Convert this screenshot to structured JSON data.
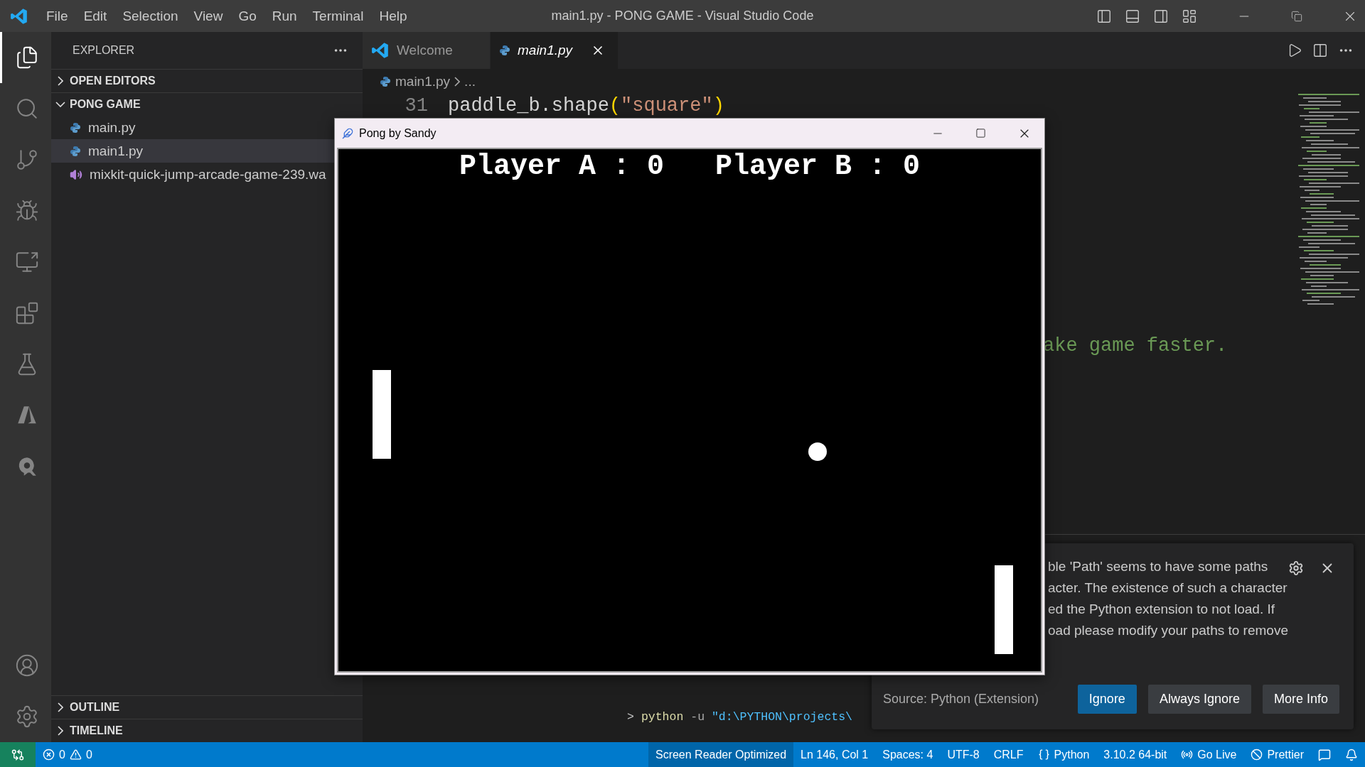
{
  "title_bar": {
    "menu": [
      "File",
      "Edit",
      "Selection",
      "View",
      "Go",
      "Run",
      "Terminal",
      "Help"
    ],
    "title": "main1.py - PONG GAME - Visual Studio Code"
  },
  "activity_bar": {
    "items": [
      {
        "kind": "files",
        "selected": true
      },
      {
        "kind": "search",
        "selected": false
      },
      {
        "kind": "source-control",
        "selected": false
      },
      {
        "kind": "run-debug",
        "selected": false
      },
      {
        "kind": "remote",
        "selected": false
      },
      {
        "kind": "extensions",
        "selected": false
      },
      {
        "kind": "testing",
        "selected": false
      },
      {
        "kind": "azure",
        "selected": false
      },
      {
        "kind": "r-logo",
        "selected": false
      }
    ],
    "bottom": [
      {
        "kind": "accounts",
        "selected": false
      },
      {
        "kind": "settings",
        "selected": false
      }
    ]
  },
  "sidebar": {
    "title": "EXPLORER",
    "sections": [
      {
        "label": "OPEN EDITORS",
        "expanded": false
      },
      {
        "label": "PONG GAME",
        "expanded": true,
        "files": [
          {
            "name": "main.py",
            "kind": "python",
            "selected": false
          },
          {
            "name": "main1.py",
            "kind": "python",
            "selected": true
          },
          {
            "name": "mixkit-quick-jump-arcade-game-239.wa",
            "kind": "audio",
            "selected": false
          }
        ]
      }
    ],
    "bottom_sections": [
      {
        "label": "OUTLINE",
        "expanded": false
      },
      {
        "label": "TIMELINE",
        "expanded": false
      }
    ]
  },
  "tabs": [
    {
      "label": "Welcome",
      "kind": "welcome",
      "selected": false
    },
    {
      "label": "main1.py",
      "kind": "python",
      "selected": true
    }
  ],
  "breadcrumb": [
    "main1.py",
    "..."
  ],
  "editor_lines": [
    {
      "number": "31",
      "tokens": [
        {
          "kind": "plain",
          "text": "paddle_b.shape"
        },
        {
          "kind": "paren",
          "text": "("
        },
        {
          "kind": "string",
          "text": "\"square\""
        },
        {
          "kind": "paren",
          "text": ")"
        }
      ]
    },
    {
      "tokens": [
        {
          "kind": "comment",
          "text": "ake game faster."
        }
      ]
    }
  ],
  "terminal": {
    "prompt": ">",
    "command": "python",
    "flag": "-u",
    "path": "\"d:\\PYTHON\\projects\\"
  },
  "notification": {
    "lines": [
      "ble 'Path' seems to have some paths",
      "acter. The existence of such a character",
      "ed the Python extension to not load. If",
      "oad please modify your paths to remove"
    ],
    "source": "Source: Python (Extension)",
    "buttons": [
      {
        "label": "Ignore",
        "primary": true
      },
      {
        "label": "Always Ignore",
        "primary": false
      },
      {
        "label": "More Info",
        "primary": false
      }
    ]
  },
  "pong_window": {
    "title": "Pong by Sandy",
    "scores": [
      "Player A : 0",
      "Player B : 0"
    ]
  },
  "status_bar": {
    "errors": "0",
    "warnings": "0",
    "items": [
      {
        "kind": "highlight",
        "text": "Screen Reader Optimized"
      },
      {
        "kind": "plain",
        "text": "Ln 146, Col 1"
      },
      {
        "kind": "plain",
        "text": "Spaces: 4"
      },
      {
        "kind": "plain",
        "text": "UTF-8"
      },
      {
        "kind": "plain",
        "text": "CRLF"
      },
      {
        "kind": "language",
        "text": "Python"
      },
      {
        "kind": "plain",
        "text": "3.10.2 64-bit"
      },
      {
        "kind": "broadcast",
        "text": "Go Live"
      },
      {
        "kind": "prettier",
        "text": "Prettier"
      }
    ]
  }
}
